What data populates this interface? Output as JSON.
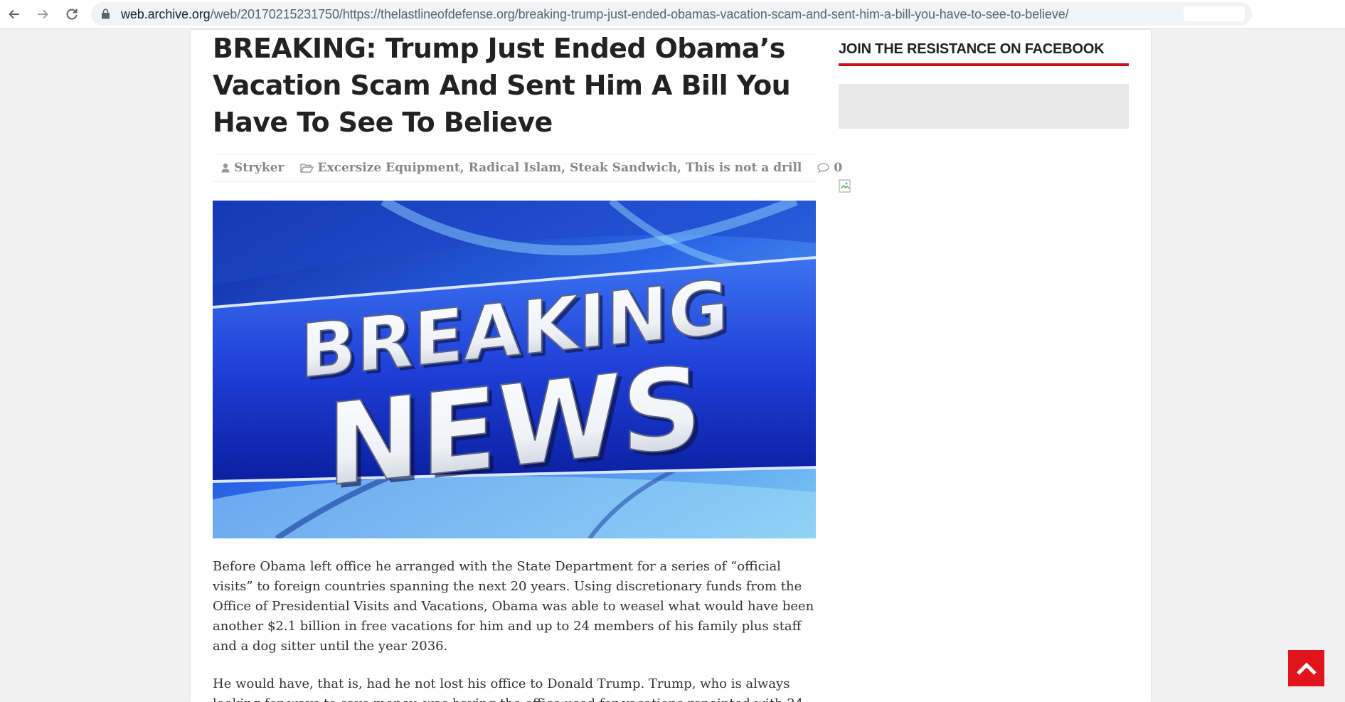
{
  "browser": {
    "url_host": "web.archive.org",
    "url_path": "/web/20170215231750/https://thelastlineofdefense.org/breaking-trump-just-ended-obamas-vacation-scam-and-sent-him-a-bill-you-have-to-see-to-believe/",
    "icons": {
      "back": "arrow-left-icon",
      "forward": "arrow-right-icon",
      "reload": "reload-icon",
      "secure": "lock-icon"
    }
  },
  "article": {
    "title": "BREAKING: Trump Just Ended Obama’s Vacation Scam And Sent Him A Bill You Have To See To Believe",
    "meta": {
      "author": "Stryker",
      "categories": [
        "Excersize Equipment",
        "Radical Islam",
        "Steak Sandwich",
        "This is not a drill"
      ],
      "separator": ", ",
      "comments": "0",
      "icons": {
        "author": "user-icon",
        "categories": "folder-open-icon",
        "comments": "comment-icon"
      }
    },
    "hero_image": {
      "line1": "BREAKING",
      "line2": "NEWS"
    },
    "paragraphs": [
      "Before Obama left office he arranged with the State Department for a series of “official visits” to foreign countries spanning the next 20 years. Using discretionary funds from the Office of Presidential Visits and Vacations, Obama was able to weasel what would have been another $2.1 billion in free vacations for him and up to 24 members of his family plus staff and a dog sitter until the year 2036.",
      "He would have, that is, had he not lost his office to Donald Trump. Trump, who is always looking for ways to save money, was having the office used for vacations repointed with 24"
    ]
  },
  "sidebar": {
    "widget_title": "JOIN THE RESISTANCE ON FACEBOOK"
  },
  "back_to_top": {
    "icon": "chevron-up-icon"
  },
  "colors": {
    "accent": "#c8131b",
    "button": "#e1141b",
    "text": "#222222",
    "meta": "#888888"
  }
}
